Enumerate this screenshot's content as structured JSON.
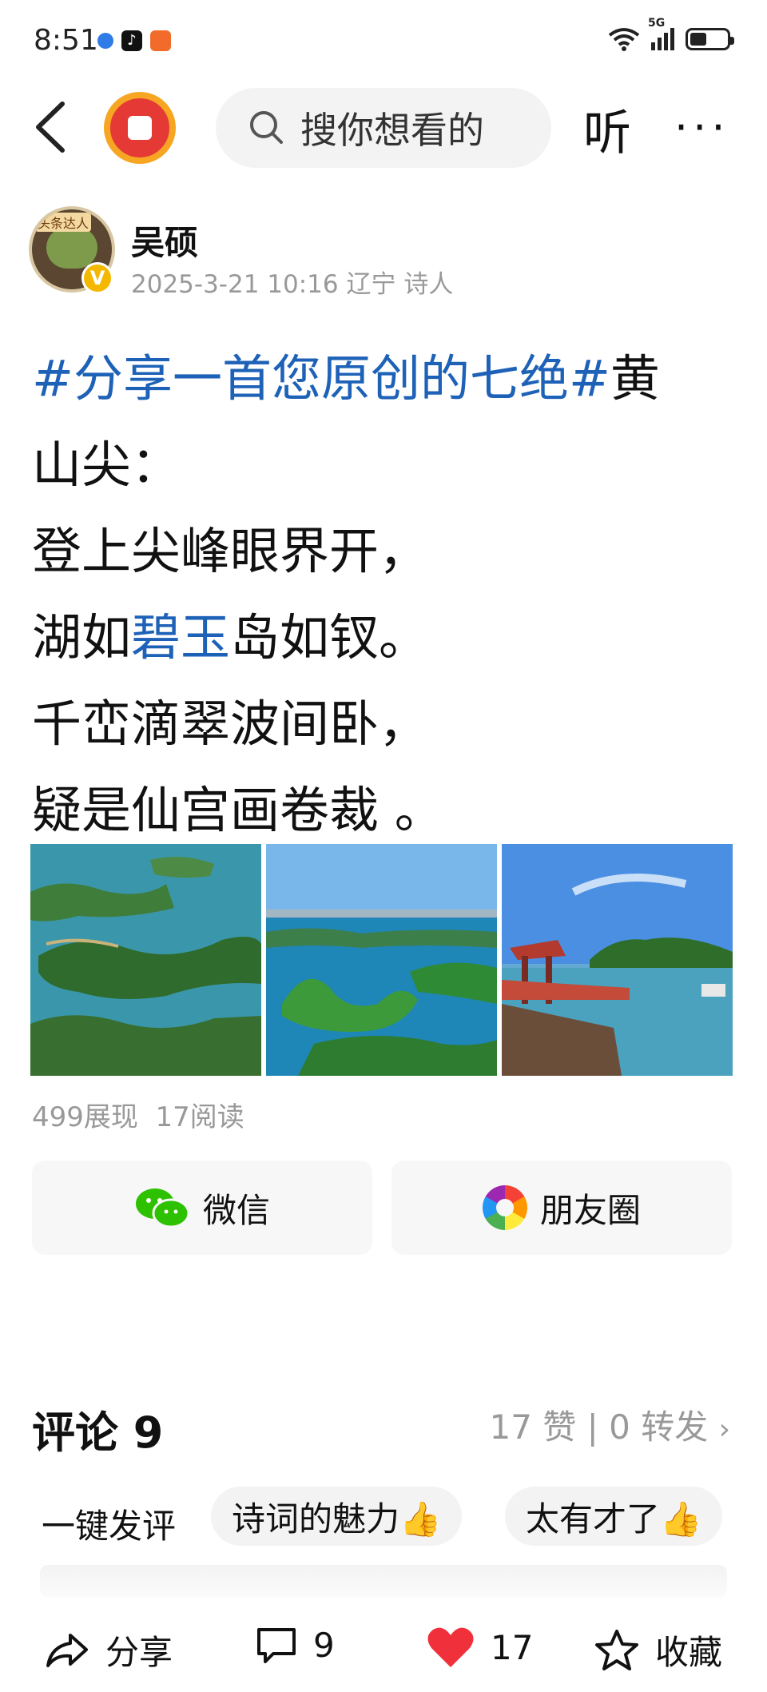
{
  "status_bar": {
    "time": "8:51",
    "network": "5G"
  },
  "nav": {
    "search_placeholder": "搜你想看的",
    "listen_label": "听",
    "more_label": "···"
  },
  "author": {
    "name": "吴硕",
    "meta": "2025-3-21 10:16 辽宁 诗人",
    "avatar_tag": "头条达人",
    "verified": true
  },
  "post": {
    "hashtag": "#分享一首您原创的七绝#",
    "title_rest_1": "黄",
    "title_rest_2": "山尖：",
    "line1": "登上尖峰眼界开，",
    "line2_pre": "湖如",
    "line2_hl": "碧玉",
    "line2_post": "岛如钗。",
    "line3": "千峦滴翠波间卧，",
    "line4": "疑是仙宫画卷裁 。"
  },
  "images": [
    {
      "name": "islands-aerial"
    },
    {
      "name": "lake-islands-panorama"
    },
    {
      "name": "pavilion-lakeside"
    }
  ],
  "stats": {
    "views": "499展现",
    "reads": "17阅读"
  },
  "share_to": {
    "wechat": "微信",
    "moments": "朋友圈"
  },
  "comments": {
    "title": "评论 9",
    "likes_reposts": "17 赞 | 0 转发"
  },
  "quick_comments": {
    "label": "一键发评",
    "chips": [
      "诗词的魅力👍",
      "太有才了👍"
    ]
  },
  "bottom_bar": {
    "share": "分享",
    "comments": "9",
    "likes": "17",
    "favorite": "收藏"
  },
  "colors": {
    "hashtag_blue": "#1e62b8",
    "like_red": "#f0303a",
    "wechat_green": "#2dc100"
  }
}
